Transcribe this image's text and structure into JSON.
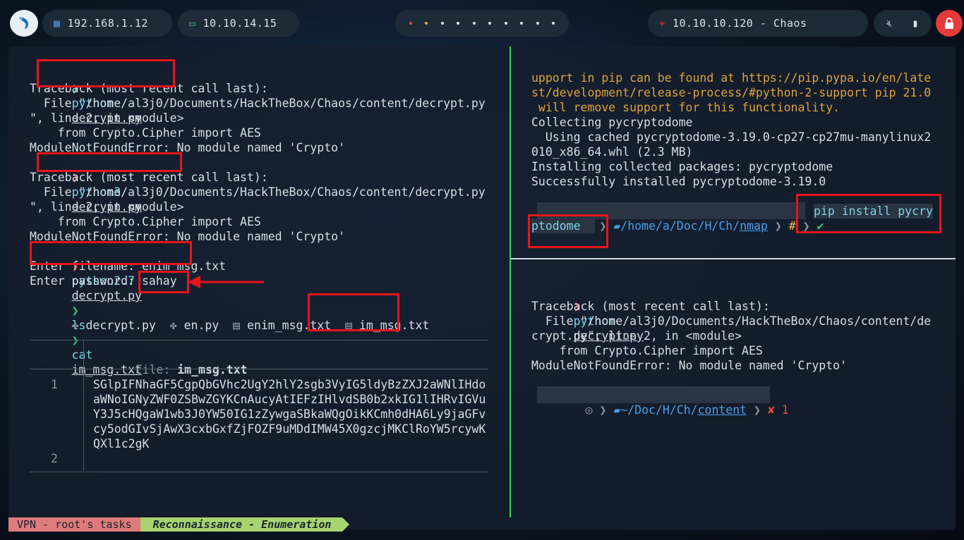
{
  "topbar": {
    "ip_local": "192.168.1.12",
    "ip_vpn": "10.10.14.15",
    "target": "10.10.10.120 - Chaos"
  },
  "left_pane": {
    "lines": [
      {
        "prompt": "❯",
        "cmd": "python",
        "arg": "decrypt.py"
      },
      "Traceback (most recent call last):",
      "  File \"/home/al3j0/Documents/HackTheBox/Chaos/content/decrypt.py",
      "\", line 2, in <module>",
      "    from Crypto.Cipher import AES",
      "ModuleNotFoundError: No module named 'Crypto'",
      {
        "prompt": "❯",
        "cmd": "python3",
        "arg": "decrypt.py"
      },
      "Traceback (most recent call last):",
      "  File \"/home/al3j0/Documents/HackTheBox/Chaos/content/decrypt.py",
      "\", line 2, in <module>",
      "    from Crypto.Cipher import AES",
      "ModuleNotFoundError: No module named 'Crypto'",
      {
        "prompt": "❯",
        "cmd": "python2.7",
        "arg": "decrypt.py"
      },
      "Enter filename: enim_msg.txt",
      {
        "label": "Enter password: ",
        "value": "sahay"
      },
      {
        "prompt": "❯",
        "cmd": "ls",
        "arg": ""
      },
      {
        "files": [
          "decrypt.py",
          "en.py",
          "enim_msg.txt",
          "im_msg.txt"
        ]
      },
      {
        "prompt": "❯",
        "cmd": "cat",
        "arg": "im_msg.txt"
      }
    ],
    "bat": {
      "file_label": "File: ",
      "file_name": "im_msg.txt",
      "line_nums": [
        "1",
        "2"
      ],
      "content": [
        "SGlpIFNhaGF5CgpQbGVhc2UgY2hlY2sgb3VyIG5ldyBzZXJ2aWNlIHdo",
        "aWNoIGNyZWF0ZSBwZGYKCnAucyAtIEFzIHlvdSB0b2xkIG1lIHRvIGVu",
        "Y3J5cHQgaW1wb3J0YW50IG1zZywgaSBkaWQgOikKCmh0dHA6Ly9jaGFv",
        "cy5odGIvSjAwX3cxbGxfZjFOZF9uMDdIMW45X0gzcjMKClRoYW5rcywK",
        "QXl1c2gK"
      ]
    }
  },
  "right_top": {
    "lines": [
      "upport in pip can be found at https://pip.pypa.io/en/late",
      "st/development/release-process/#python-2-support pip 21.0",
      " will remove support for this functionality.",
      "Collecting pycryptodome",
      "  Using cached pycryptodome-3.19.0-cp27-cp27mu-manylinux2",
      "010_x86_64.whl (2.3 MB)",
      "Installing collected packages: pycryptodome",
      "Successfully installed pycryptodome-3.19.0"
    ],
    "prompt": {
      "path_prefix": "/home/a/Doc/H/Ch/",
      "path_dir": "nmap",
      "hash": "#",
      "check": "✔",
      "cmd1": "pip install pycry",
      "cmd2": "ptodome"
    }
  },
  "right_bottom": {
    "cmd": "python",
    "arg": "decrypt.py",
    "lines": [
      "Traceback (most recent call last):",
      "  File \"/home/al3j0/Documents/HackTheBox/Chaos/content/de",
      "crypt.py\", line 2, in <module>",
      "    from Crypto.Cipher import AES",
      "ModuleNotFoundError: No module named 'Crypto'"
    ],
    "prompt": {
      "path_prefix": "~/Doc/H/Ch/",
      "path_dir": "content",
      "error": "✘ 1"
    }
  },
  "statusbar": {
    "session": "VPN - root's tasks",
    "window": "Reconnaissance - Enumeration"
  },
  "colors": {
    "accent_red": "#e8141c",
    "split_green": "#3fd05a",
    "prompt_green": "#2ec47a",
    "prompt_red": "#e5483f",
    "orange_warning": "#e0a33a"
  }
}
